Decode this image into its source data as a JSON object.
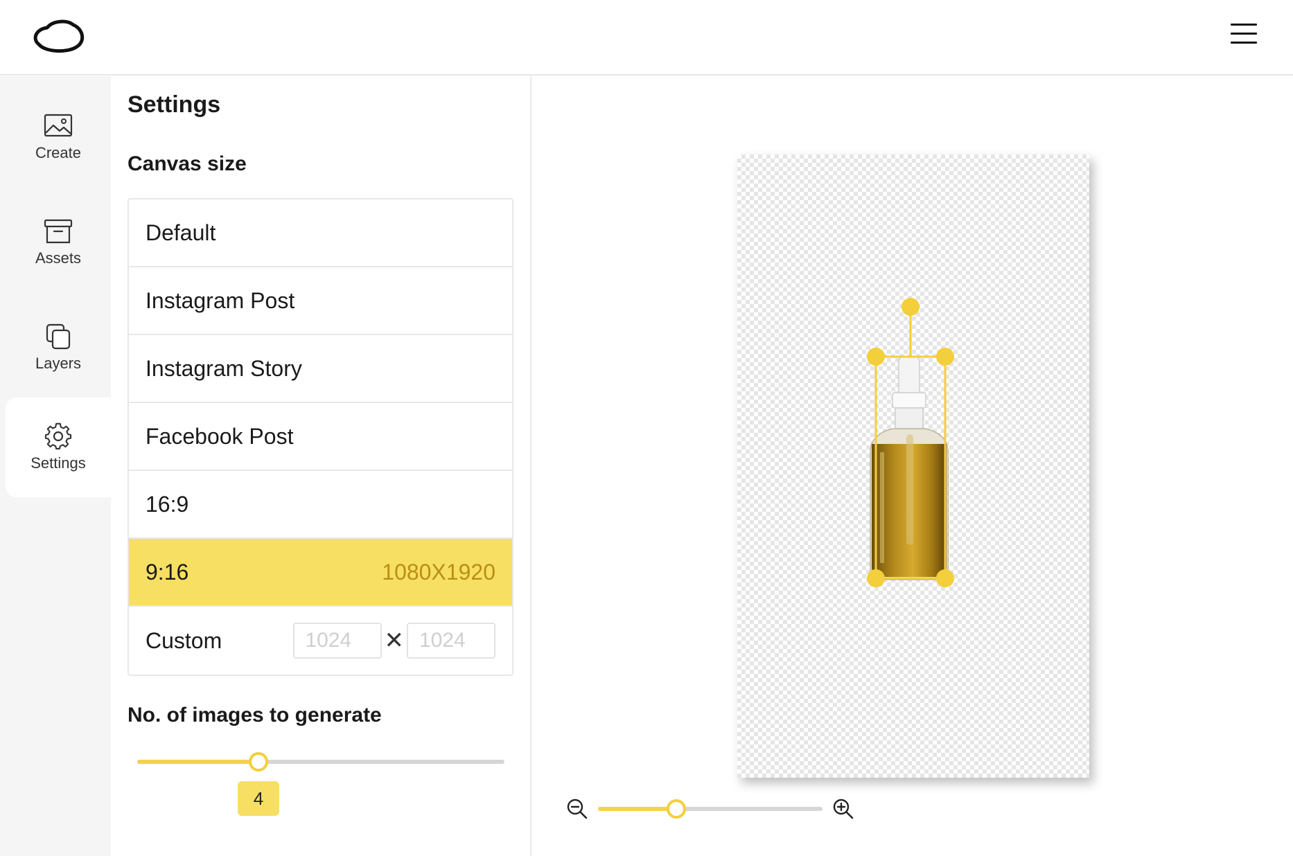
{
  "header": {
    "logo_icon": "cloud-outline-icon",
    "menu_icon": "hamburger-icon"
  },
  "sidebar": {
    "items": [
      {
        "label": "Create",
        "icon": "image-icon",
        "active": false
      },
      {
        "label": "Assets",
        "icon": "archive-box-icon",
        "active": false
      },
      {
        "label": "Layers",
        "icon": "layers-icon",
        "active": false
      },
      {
        "label": "Settings",
        "icon": "gear-icon",
        "active": true
      }
    ]
  },
  "settings": {
    "title": "Settings",
    "canvas_size": {
      "title": "Canvas size",
      "options": [
        {
          "label": "Default"
        },
        {
          "label": "Instagram Post"
        },
        {
          "label": "Instagram Story"
        },
        {
          "label": "Facebook Post"
        },
        {
          "label": "16:9"
        },
        {
          "label": "9:16",
          "dimensions": "1080X1920",
          "selected": true
        },
        {
          "label": "Custom"
        }
      ],
      "custom": {
        "width_placeholder": "1024",
        "height_placeholder": "1024",
        "separator": "✕"
      }
    },
    "images_to_generate": {
      "title": "No. of images to generate",
      "value": "4",
      "fraction": 0.33
    }
  },
  "canvas": {
    "zoom_fraction": 0.35,
    "zoom_out_icon": "zoom-out-icon",
    "zoom_in_icon": "zoom-in-icon"
  },
  "colors": {
    "accent": "#f7df63",
    "accent_strong": "#f4cf3c",
    "dimension_text": "#b88f14"
  }
}
